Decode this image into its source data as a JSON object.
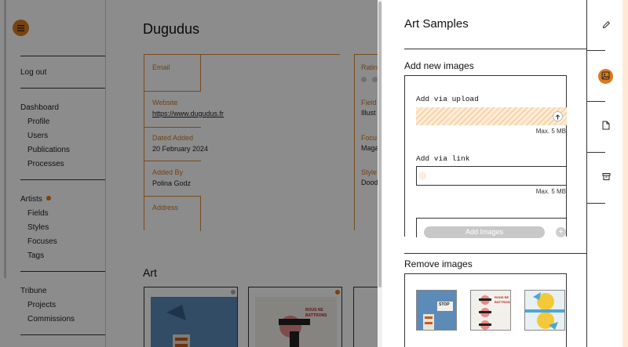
{
  "background": {
    "nav": {
      "logout": "Log out",
      "dashboard": "Dashboard",
      "dashboard_items": [
        "Profile",
        "Users",
        "Publications",
        "Processes"
      ],
      "artists": "Artists",
      "artists_items": [
        "Fields",
        "Styles",
        "Focuses",
        "Tags"
      ],
      "tribune": "Tribune",
      "tribune_items": [
        "Projects",
        "Commissions"
      ]
    },
    "title": "Dugudus",
    "fields": {
      "email_label": "Email",
      "website_label": "Website",
      "website_value": "https://www.dugudus.fr",
      "dated_added_label": "Dated Added",
      "dated_added_value": "20 February 2024",
      "added_by_label": "Added By",
      "added_by_value": "Polina Godz",
      "address_label": "Address"
    },
    "right_column": {
      "rating_label": "Ratin",
      "fields_label": "Field",
      "fields_value": "Illust",
      "focus_label": "Focu",
      "focus_value": "Maga",
      "style_label": "Style",
      "style_value": "Dood"
    },
    "art_heading": "Art",
    "poster_text": "ROUS NE BATTRONS"
  },
  "drawer": {
    "title": "Art Samples",
    "add_section": "Add new images",
    "upload_label": "Add via upload",
    "upload_hint": "Max. 5 MB",
    "link_label": "Add via link",
    "link_value": "",
    "link_hint": "Max. 5 MB",
    "add_button": "Add Images",
    "remove_section": "Remove images",
    "thumb_text_1": "STOP",
    "thumb_text_2": "RONS RE BATTRONS"
  },
  "rail": {
    "icons": [
      "edit-icon",
      "image-icon",
      "document-icon",
      "archive-icon"
    ],
    "active": "image-icon"
  },
  "colors": {
    "accent": "#d97a1e",
    "accent_light": "#fde9d6",
    "label": "#c97a2a"
  }
}
